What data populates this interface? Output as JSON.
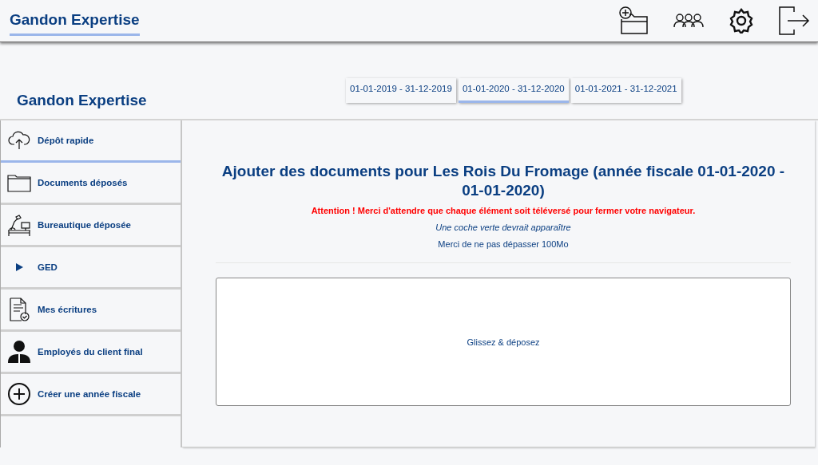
{
  "header": {
    "title": "Gandon Expertise"
  },
  "company": {
    "name": "Gandon Expertise"
  },
  "tabs": [
    {
      "label": "01-01-2019 - 31-12-2019",
      "selected": false
    },
    {
      "label": "01-01-2020 - 31-12-2020",
      "selected": true
    },
    {
      "label": "01-01-2021 - 31-12-2021",
      "selected": false
    }
  ],
  "sidebar": {
    "items": [
      {
        "label": "Dépôt rapide",
        "selected": true
      },
      {
        "label": "Documents déposés",
        "selected": false
      },
      {
        "label": "Bureautique déposée",
        "selected": false
      },
      {
        "label": "GED",
        "selected": false,
        "expanded": false
      },
      {
        "label": "Mes écritures",
        "selected": false
      },
      {
        "label": "Employés du client final",
        "selected": false
      },
      {
        "label": "Créer une année fiscale",
        "selected": false
      }
    ]
  },
  "main": {
    "heading": "Ajouter des documents pour Les Rois Du Fromage (année fiscale 01-01-2020 - 01-01-2020)",
    "warning": "Attention ! Merci d'attendre que chaque élément soit téléversé pour fermer votre navigateur.",
    "hint": "Une coche verte devrait apparaître",
    "limit": "Merci de ne pas dépasser 100Mo",
    "dropzone": "Glissez & déposez"
  }
}
